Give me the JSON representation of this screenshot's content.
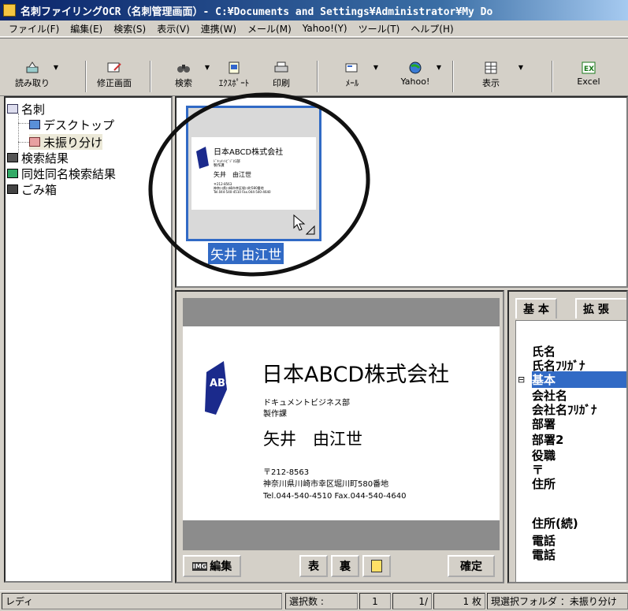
{
  "window": {
    "title": "名刺ファイリングOCR（名刺管理画面）- C:¥Documents and Settings¥Administrator¥My Do"
  },
  "menu": [
    "ファイル(F)",
    "編集(E)",
    "検索(S)",
    "表示(V)",
    "連携(W)",
    "メール(M)",
    "Yahoo!(Y)",
    "ツール(T)",
    "ヘルプ(H)"
  ],
  "toolbar": {
    "read": "読み取り",
    "edit_screen": "修正画面",
    "search": "検索",
    "export": "ｴｸｽﾎﾟｰﾄ",
    "print": "印刷",
    "mail": "ﾒｰﾙ",
    "yahoo": "Yahoo!",
    "view": "表示",
    "excel": "Excel"
  },
  "tree": {
    "root": "名刺",
    "desktop": "デスクトップ",
    "unsorted": "未振り分け",
    "search_results": "検索結果",
    "same_name_results": "同姓同名検索結果",
    "trash": "ごみ箱"
  },
  "thumbnail": {
    "caption": "矢井 由江世"
  },
  "card": {
    "company": "日本ABCD株式会社",
    "department": "ドキュメントビジネス部",
    "section": "製作課",
    "name": "矢井　由江世",
    "postal": "〒212-8563",
    "address": "神奈川県川崎市幸区堀川町580番地",
    "phone": "Tel.044-540-4510 Fax.044-540-4640",
    "logo_text": "ABCD"
  },
  "thumb_card": {
    "company": "日本ABCD株式会社",
    "dept": "ﾄﾞｷｭﾒﾝﾄﾋﾞｼﾞﾈｽ部",
    "section": "製作課",
    "name": "矢井　由江世",
    "postal": "〒212-8563",
    "address": "神奈川県川崎市幸区堀川町580番地",
    "phone": "Tel.044-540-4510 Fax.044-540-4640"
  },
  "detail_buttons": {
    "edit": "編集",
    "confirm": "確定",
    "img_label": "IMG"
  },
  "fields": {
    "tabs": [
      "基 本",
      "拡 張"
    ],
    "rows": [
      "氏名",
      "氏名ﾌﾘｶﾞﾅ",
      "基本",
      "会社名",
      "会社名ﾌﾘｶﾞﾅ",
      "部署",
      "部署2",
      "役職",
      "〒",
      "住所",
      "住所(続)",
      "電話",
      "電話"
    ],
    "collapse_marker": "⊟"
  },
  "status": {
    "ready": "レディ",
    "selected_label": "選択数 :",
    "selected_count": "1",
    "page": "1/",
    "total": "1 枚",
    "folder": "現選択フォルダ ：未振り分け"
  },
  "colors": {
    "selection": "#316ac5",
    "face": "#d4d0c8",
    "title_start": "#0a246a"
  }
}
